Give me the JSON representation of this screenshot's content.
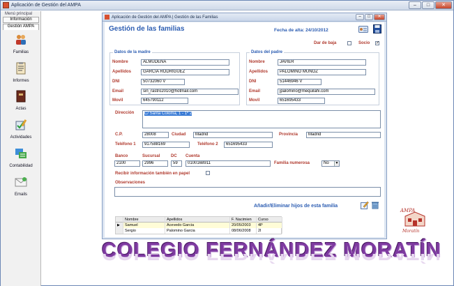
{
  "window": {
    "title": "Aplicación de Gestión del AMPA",
    "buttons": {
      "minimize": "–",
      "maximize": "□",
      "close": "✕"
    }
  },
  "sidebar": {
    "menu_label": "Menú principal",
    "tabs": [
      "Información",
      "Gestión AMPA"
    ],
    "items": [
      {
        "label": "Familias",
        "icon": "families-icon"
      },
      {
        "label": "Informes",
        "icon": "reports-icon"
      },
      {
        "label": "Actas",
        "icon": "minutes-book-icon"
      },
      {
        "label": "Actividades",
        "icon": "activities-icon"
      },
      {
        "label": "Contabilidad",
        "icon": "accounting-icon"
      },
      {
        "label": "Emails",
        "icon": "email-icon"
      }
    ]
  },
  "inner_window": {
    "title": "Aplicación de Gestión del AMPA | Gestión de las Familias",
    "buttons": {
      "minimize": "–",
      "maximize": "□",
      "close": "✕"
    }
  },
  "form": {
    "title": "Gestión de las familias",
    "fecha_alta": "Fecha de alta: 24/10/2012",
    "dar_de_baja_label": "Dar de baja",
    "dar_de_baja_checked": false,
    "socio_label": "Socio",
    "socio_checked": true,
    "madre": {
      "legend": "Datos de la madre",
      "labels": {
        "nombre": "Nombre",
        "apellidos": "Apellidos",
        "dni": "DNI",
        "email": "Email",
        "movil": "Movil"
      },
      "nombre": "ALMUDENA",
      "apellidos": "GARCIA RODRIGUEZ",
      "dni": "50732060 V",
      "email": "sin_rastro2010@hotmail.com",
      "movil": "645790112"
    },
    "padre": {
      "legend": "Datos del padre",
      "labels": {
        "nombre": "Nombre",
        "apellidos": "Apellidos",
        "dni": "DNI",
        "email": "Email",
        "movil": "Movil"
      },
      "nombre": "JAVIER",
      "apellidos": "PALOMINO MUÑOZ",
      "dni": "51446946 V",
      "email": "jpalomino@mequilahi.com",
      "movil": "651695433"
    },
    "direccion_label": "Dirección",
    "direccion": "C/ Santa Coloma, 1 - 1º 2",
    "cp_label": "C.P.",
    "cp": "28008",
    "ciudad_label": "Ciudad",
    "ciudad": "Madrid",
    "provincia_label": "Provincia",
    "provincia": "Madrid",
    "telefono1_label": "Teléfono 1",
    "telefono1": "917588169",
    "telefono2_label": "Teléfono 2",
    "telefono2": "651695433",
    "banco_label": "Banco",
    "banco": "2100",
    "sucursal_label": "Sucursal",
    "sucursal": "2996",
    "dc_label": "DC",
    "dc": "59",
    "cuenta_label": "Cuenta",
    "cuenta": "0100168911",
    "familia_numerosa_label": "Familia numerosa",
    "familia_numerosa": "No",
    "recibir_papel_label": "Recibir información también en papel",
    "recibir_papel_checked": false,
    "observaciones_label": "Observaciones",
    "observaciones": "",
    "hijos_link": "Añadir/Eliminar hijos de esta familia"
  },
  "hijos_grid": {
    "columns": [
      "Nombre",
      "Apellidos",
      "F. Nacimien",
      "Curso"
    ],
    "rows": [
      {
        "nombre": "Samuel",
        "apellidos": "Acevedo Garcia",
        "fnac": "20/05/2003",
        "curso": "4P"
      },
      {
        "nombre": "Sergio",
        "apellidos": "Palomino Garcia",
        "fnac": "08/06/2008",
        "curso": "2I"
      }
    ],
    "selected_marker": "▶"
  },
  "banner": {
    "text": "COLEGIO FERNÁNDEZ MORATÍN"
  },
  "logo": {
    "top_text": "AMPA",
    "bottom_text": "Moratín"
  },
  "colors": {
    "accent_blue": "#2c5db2",
    "label_red": "#b03a2e",
    "banner_purple": "#7e3aa0"
  }
}
